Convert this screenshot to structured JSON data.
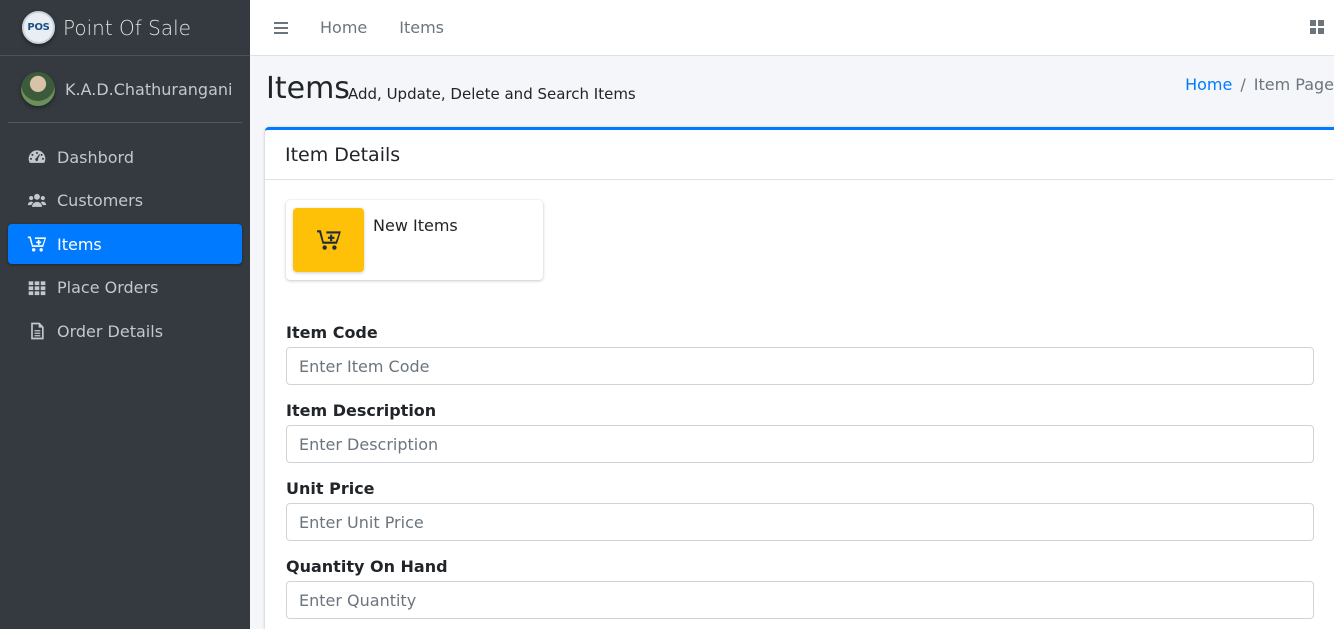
{
  "brand": {
    "logo_text": "POS",
    "title": "Point Of Sale"
  },
  "user": {
    "name": "K.A.D.Chathurangani"
  },
  "sidebar": {
    "items": [
      {
        "label": "Dashbord",
        "icon": "tachometer-icon",
        "active": false
      },
      {
        "label": "Customers",
        "icon": "users-icon",
        "active": false
      },
      {
        "label": "Items",
        "icon": "cart-plus-icon",
        "active": true
      },
      {
        "label": "Place Orders",
        "icon": "grid-icon",
        "active": false
      },
      {
        "label": "Order Details",
        "icon": "file-icon",
        "active": false
      }
    ]
  },
  "topbar": {
    "links": [
      "Home",
      "Items"
    ]
  },
  "header": {
    "title": "Items",
    "subtitle": "Add, Update, Delete and Search Items",
    "breadcrumb": {
      "home": "Home",
      "separator": "/",
      "current": "Item Page"
    }
  },
  "card": {
    "title": "Item Details",
    "info_box": {
      "label": "New Items",
      "icon": "cart-plus-icon"
    },
    "fields": [
      {
        "label": "Item Code",
        "placeholder": "Enter Item Code"
      },
      {
        "label": "Item Description",
        "placeholder": "Enter Description"
      },
      {
        "label": "Unit Price",
        "placeholder": "Enter Unit Price"
      },
      {
        "label": "Quantity On Hand",
        "placeholder": "Enter Quantity"
      }
    ]
  },
  "colors": {
    "primary": "#007bff",
    "sidebar_bg": "#343a40",
    "info_icon_bg": "#ffc107"
  }
}
